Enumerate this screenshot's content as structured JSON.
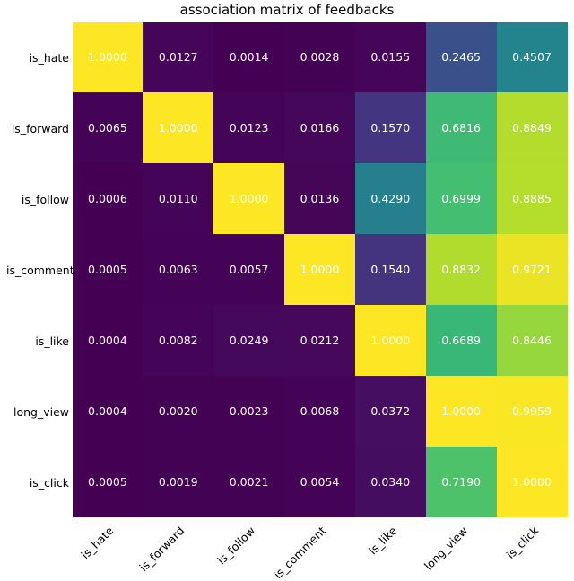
{
  "chart_data": {
    "type": "heatmap",
    "title": "association matrix of feedbacks",
    "xlabel": "",
    "ylabel": "",
    "x_categories": [
      "is_hate",
      "is_forward",
      "is_follow",
      "is_comment",
      "is_like",
      "long_view",
      "is_click"
    ],
    "y_categories": [
      "is_hate",
      "is_forward",
      "is_follow",
      "is_comment",
      "is_like",
      "long_view",
      "is_click"
    ],
    "values": [
      [
        1.0,
        0.0127,
        0.0014,
        0.0028,
        0.0155,
        0.2465,
        0.4507
      ],
      [
        0.0065,
        1.0,
        0.0123,
        0.0166,
        0.157,
        0.6816,
        0.8849
      ],
      [
        0.0006,
        0.011,
        1.0,
        0.0136,
        0.429,
        0.6999,
        0.8885
      ],
      [
        0.0005,
        0.0063,
        0.0057,
        1.0,
        0.154,
        0.8832,
        0.9721
      ],
      [
        0.0004,
        0.0082,
        0.0249,
        0.0212,
        1.0,
        0.6689,
        0.8446
      ],
      [
        0.0004,
        0.002,
        0.0023,
        0.0068,
        0.0372,
        1.0,
        0.9959
      ],
      [
        0.0005,
        0.0019,
        0.0021,
        0.0054,
        0.034,
        0.719,
        1.0
      ]
    ],
    "colorscale": "viridis",
    "vlim": [
      0,
      1
    ]
  }
}
